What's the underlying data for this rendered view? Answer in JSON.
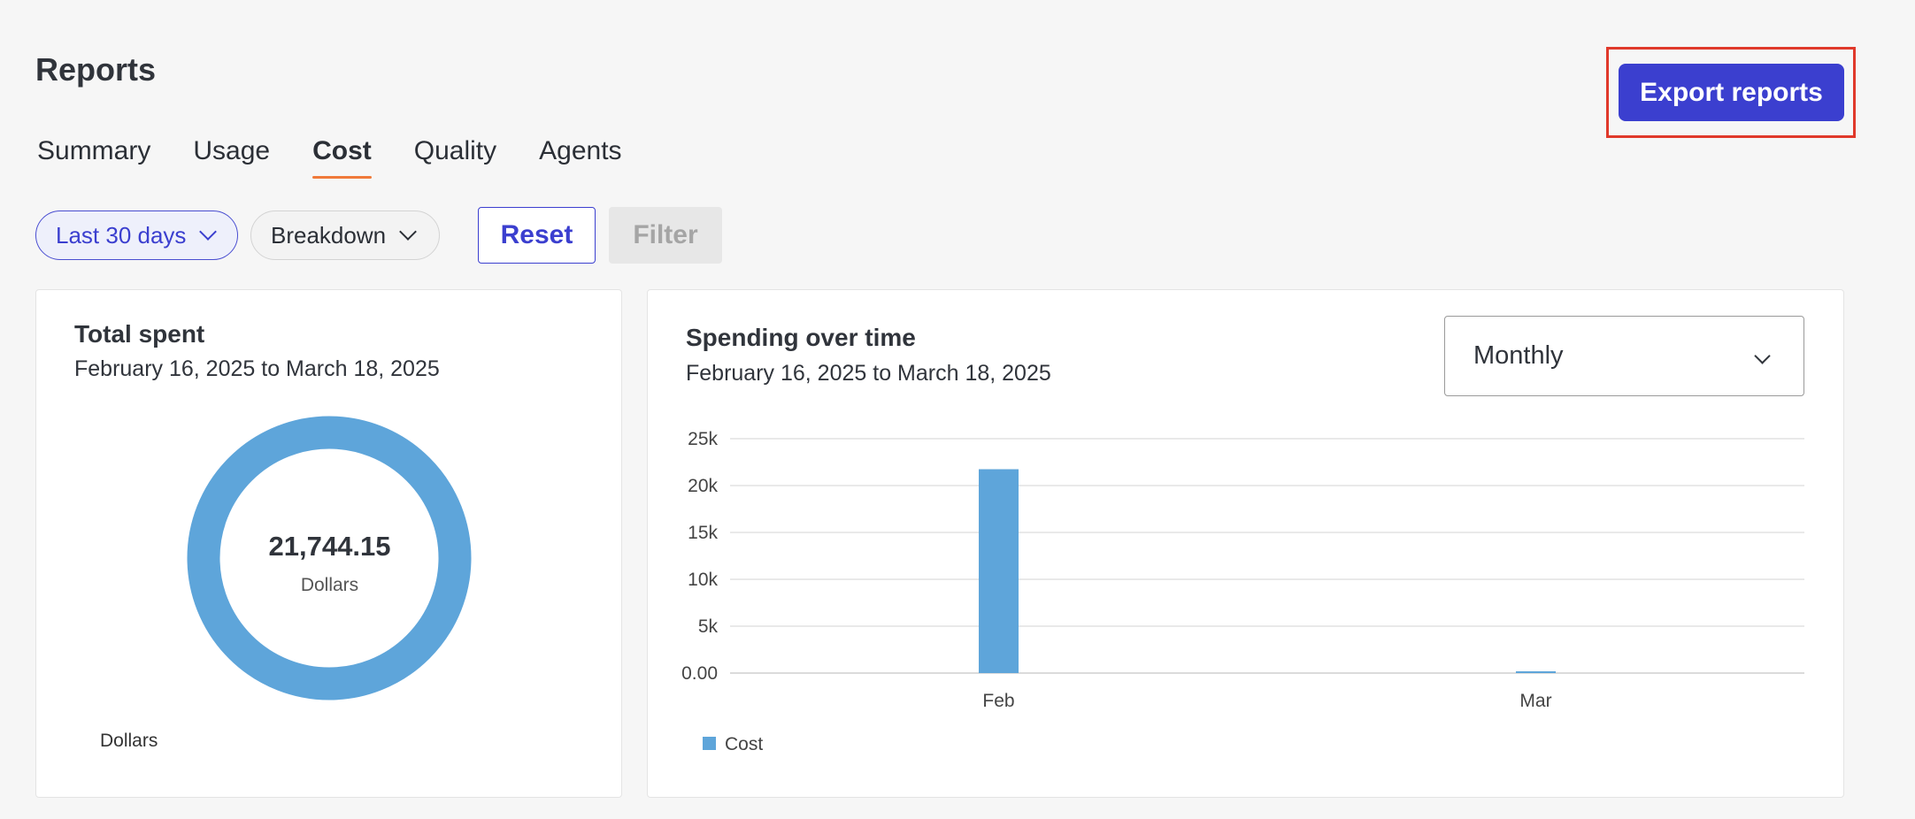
{
  "header": {
    "title": "Reports",
    "export_label": "Export reports"
  },
  "tabs": [
    {
      "label": "Summary",
      "active": false
    },
    {
      "label": "Usage",
      "active": false
    },
    {
      "label": "Cost",
      "active": true
    },
    {
      "label": "Quality",
      "active": false
    },
    {
      "label": "Agents",
      "active": false
    }
  ],
  "filters": {
    "period": "Last 30 days",
    "breakdown": "Breakdown",
    "reset_label": "Reset",
    "filter_label": "Filter"
  },
  "total_card": {
    "title": "Total spent",
    "date_range": "February 16, 2025 to March 18, 2025",
    "value": "21,744.15",
    "unit": "Dollars",
    "legend": "Dollars"
  },
  "spend_card": {
    "title": "Spending over time",
    "date_range": "February 16, 2025 to March 18, 2025",
    "granularity": "Monthly"
  },
  "colors": {
    "accent": "#3b3fcf",
    "bar": "#5ea5da",
    "tab_underline": "#f07a3a",
    "highlight": "#e0392b"
  },
  "chart_data": {
    "type": "bar",
    "categories": [
      "Feb",
      "Mar"
    ],
    "series": [
      {
        "name": "Cost",
        "values": [
          21744.15,
          0
        ]
      }
    ],
    "ylim": [
      0,
      25000
    ],
    "yticks": [
      0,
      5000,
      10000,
      15000,
      20000,
      25000
    ],
    "ytick_labels": [
      "0.00",
      "5k",
      "10k",
      "15k",
      "20k",
      "25k"
    ],
    "xlabel": "",
    "ylabel": "",
    "grid": true,
    "legend": "bottom-left"
  }
}
